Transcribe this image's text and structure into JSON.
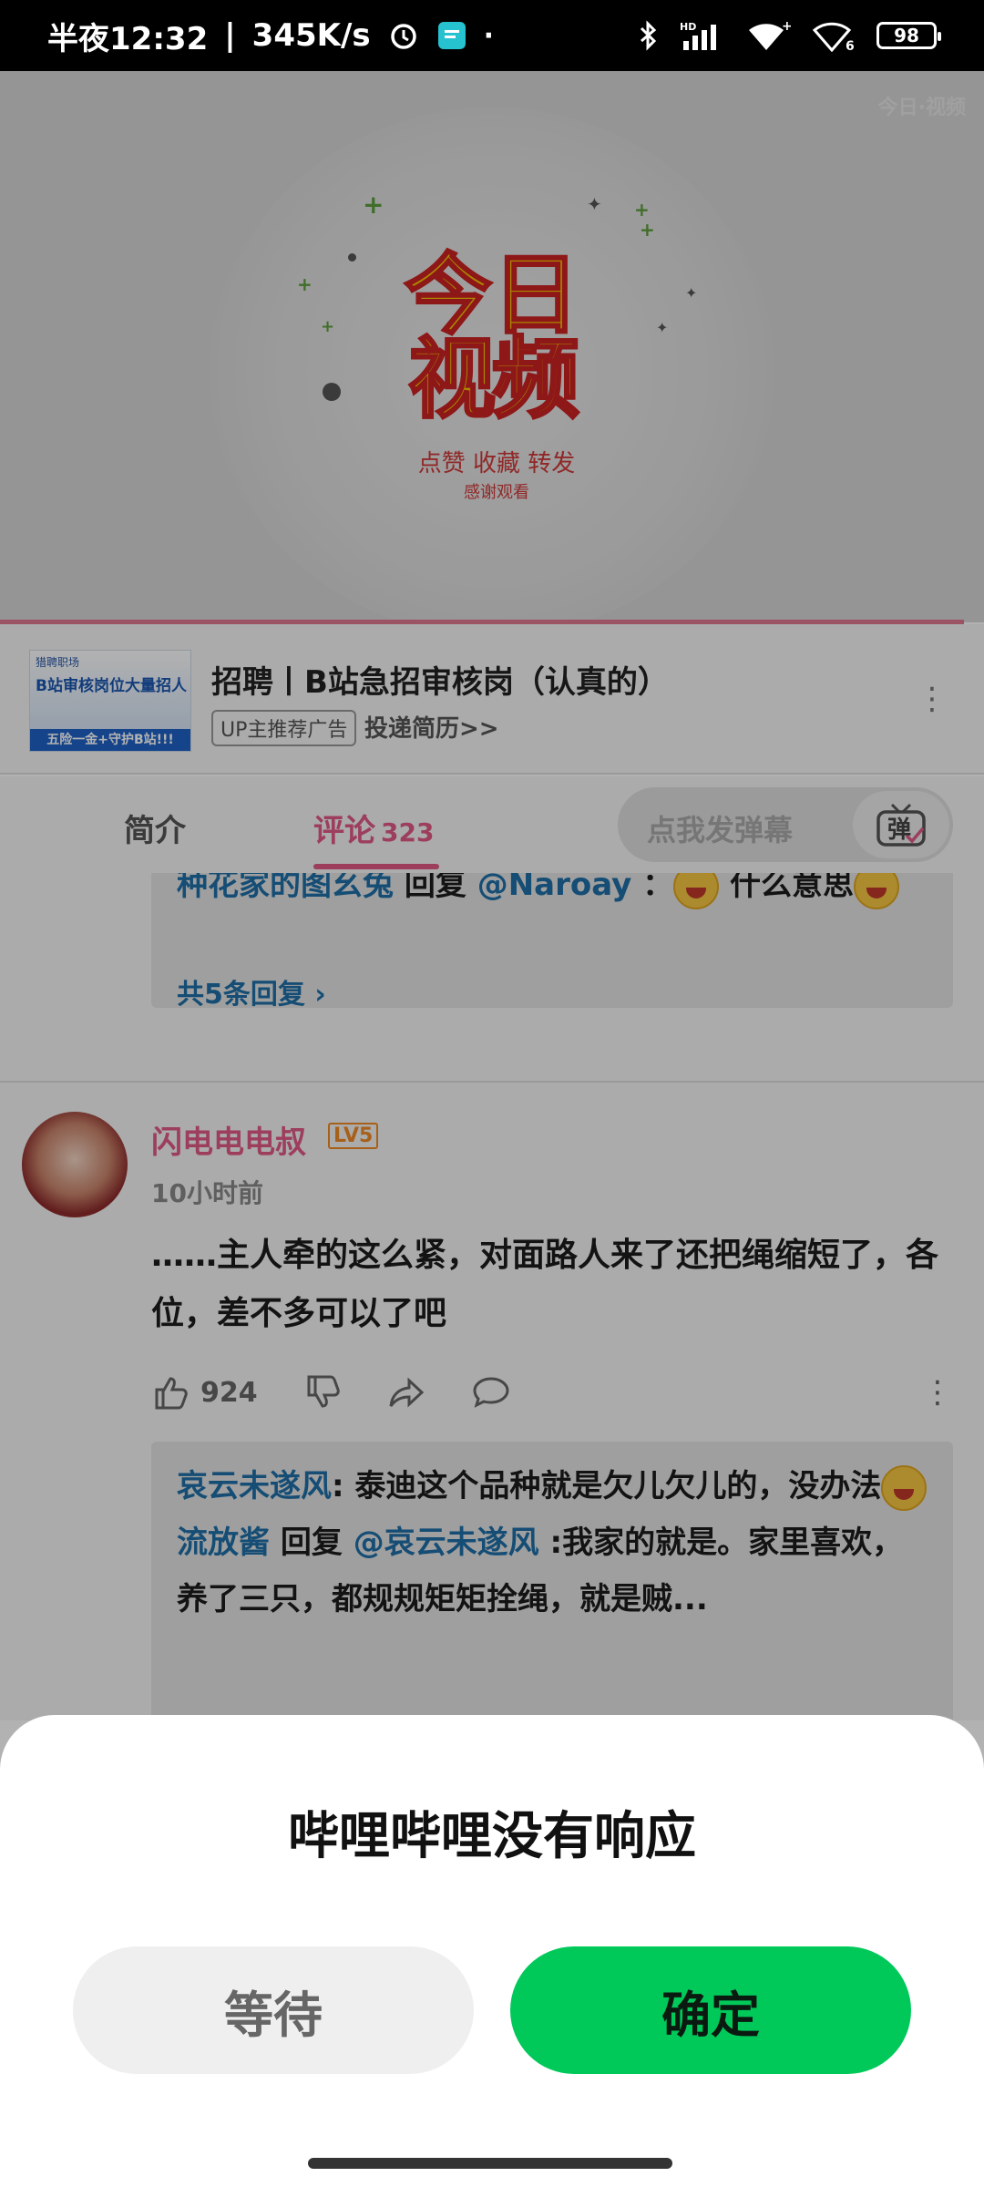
{
  "status_bar": {
    "time": "半夜12:32",
    "net_speed": "345K/s",
    "battery": "98",
    "icons": [
      "alarm-icon",
      "app-notification-icon",
      "bluetooth-icon",
      "hd-signal-icon",
      "wifi-icon",
      "wifi-6-icon",
      "battery-icon"
    ]
  },
  "video": {
    "watermark": "今日·视频",
    "logo_line1": "今日",
    "logo_line2": "视频",
    "subtitle": "点赞  收藏  转发",
    "subtitle2": "感谢观看",
    "progress_fraction": 0.98
  },
  "ad": {
    "thumb_top": "猎聘职场",
    "thumb_headline": "B站审核岗位大量招人",
    "thumb_bottom": "五险一金+守护B站!!!",
    "title": "招聘丨B站急招审核岗（认真的）",
    "badge": "UP主推荐广告",
    "link": "投递简历>>"
  },
  "tabs": {
    "intro": "简介",
    "comments": "评论",
    "comments_count": "323",
    "danmaku_placeholder": "点我发弹幕",
    "danmaku_button": "弹"
  },
  "reply_block_1": {
    "user": "种花家的图幺兔",
    "reply_word": "回复",
    "mention": "@Naroay",
    "text": "：",
    "text2": "什么意思",
    "more_replies": "共5条回复"
  },
  "comment": {
    "user": "闪电电电叔",
    "level": "LV5",
    "time": "10小时前",
    "text": "……主人牵的这么紧，对面路人来了还把绳缩短了，各位，差不多可以了吧",
    "likes": "924"
  },
  "reply_block_2": {
    "user1": "哀云未遂风",
    "text1": ": 泰迪这个品种就是欠儿欠儿的，没办法",
    "user2": "流放酱",
    "reply_word": "回复",
    "mention": "@哀云未遂风",
    "text2": ":我家的就是。家里喜欢，养了三只，都规规矩矩拴绳，就是贼..."
  },
  "dialog": {
    "title": "哔哩哔哩没有响应",
    "wait_label": "等待",
    "ok_label": "确定"
  }
}
